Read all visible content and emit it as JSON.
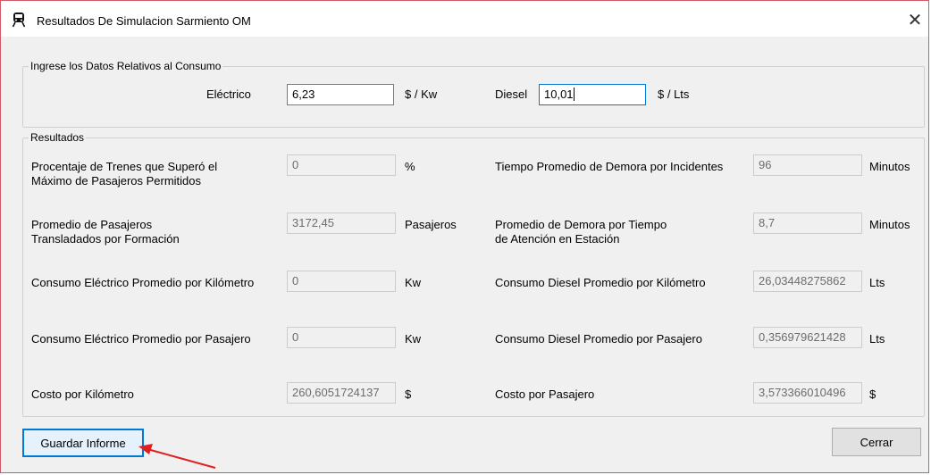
{
  "window": {
    "title": "Resultados De Simulacion Sarmiento OM",
    "app_icon": "train-icon",
    "close_glyph": "✕",
    "accent_border": "#cf5a6a"
  },
  "consumo": {
    "legend": "Ingrese los Datos Relativos al Consumo",
    "electrico_label": "Eléctrico",
    "electrico_value": "6,23",
    "electrico_unit": "$ / Kw",
    "diesel_label": "Diesel",
    "diesel_value": "10,01",
    "diesel_unit": "$ / Lts"
  },
  "resultados": {
    "legend": "Resultados",
    "left": [
      {
        "label": [
          "Procentaje de Trenes que Superó el",
          "Máximo de Pasajeros Permitidos"
        ],
        "value": "0",
        "unit": "%"
      },
      {
        "label": [
          "Promedio de Pasajeros",
          "Transladados por Formación"
        ],
        "value": "3172,45",
        "unit": "Pasajeros"
      },
      {
        "label": [
          "Consumo Eléctrico Promedio por Kilómetro"
        ],
        "value": "0",
        "unit": "Kw"
      },
      {
        "label": [
          "Consumo Eléctrico Promedio por Pasajero"
        ],
        "value": "0",
        "unit": "Kw"
      },
      {
        "label": [
          "Costo por Kilómetro"
        ],
        "value": "260,6051724137",
        "unit": "$"
      }
    ],
    "right": [
      {
        "label": [
          "Tiempo Promedio de Demora por Incidentes"
        ],
        "value": "96",
        "unit": "Minutos"
      },
      {
        "label": [
          "Promedio de Demora por Tiempo",
          "de Atención en Estación"
        ],
        "value": "8,7",
        "unit": "Minutos"
      },
      {
        "label": [
          "Consumo Diesel Promedio por Kilómetro"
        ],
        "value": "26,03448275862",
        "unit": "Lts"
      },
      {
        "label": [
          "Consumo Diesel Promedio por Pasajero"
        ],
        "value": "0,356979621428",
        "unit": "Lts"
      },
      {
        "label": [
          "Costo por Pasajero"
        ],
        "value": "3,573366010496",
        "unit": "$"
      }
    ]
  },
  "buttons": {
    "guardar": "Guardar Informe",
    "cerrar": "Cerrar"
  },
  "colors": {
    "focus_blue": "#0078d7",
    "annotation_red": "#e02020"
  }
}
